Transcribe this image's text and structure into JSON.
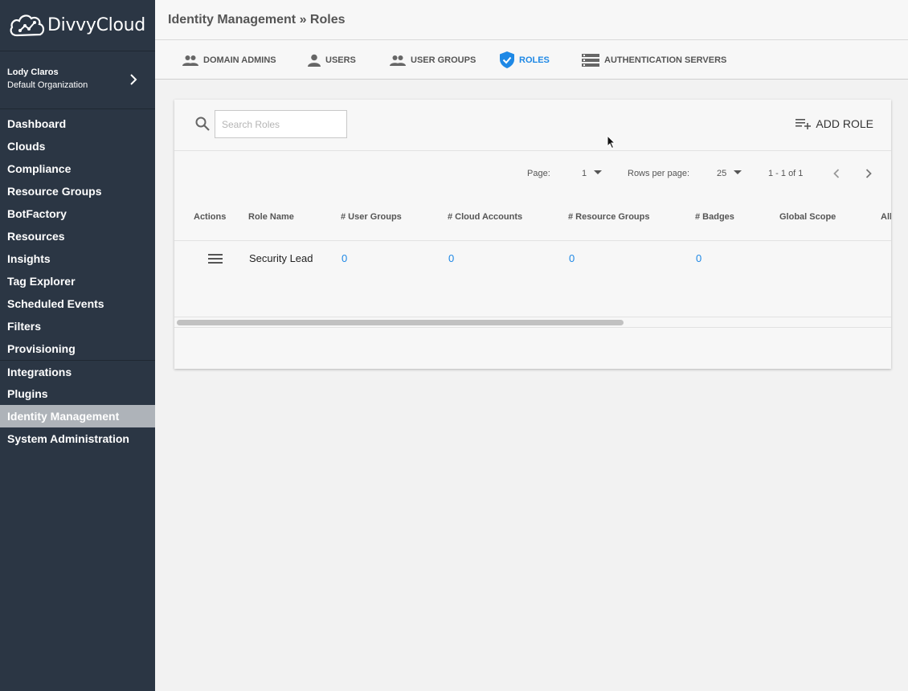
{
  "app": {
    "brand": "DivvyCloud"
  },
  "user": {
    "name": "Lody Claros",
    "org": "Default Organization"
  },
  "sidebar": {
    "items": [
      {
        "label": "Dashboard"
      },
      {
        "label": "Clouds"
      },
      {
        "label": "Compliance"
      },
      {
        "label": "Resource Groups"
      },
      {
        "label": "BotFactory"
      },
      {
        "label": "Resources"
      },
      {
        "label": "Insights"
      },
      {
        "label": "Tag Explorer"
      },
      {
        "label": "Scheduled Events"
      },
      {
        "label": "Filters"
      },
      {
        "label": "Provisioning"
      },
      {
        "label": "Integrations"
      },
      {
        "label": "Plugins"
      },
      {
        "label": "Identity Management"
      },
      {
        "label": "System Administration"
      }
    ],
    "active": "Identity Management"
  },
  "header": {
    "breadcrumb": "Identity Management » Roles"
  },
  "tabs": [
    {
      "label": "DOMAIN ADMINS",
      "icon": "people-icon"
    },
    {
      "label": "USERS",
      "icon": "person-icon"
    },
    {
      "label": "USER GROUPS",
      "icon": "people-icon"
    },
    {
      "label": "ROLES",
      "icon": "shield-check-icon",
      "active": true
    },
    {
      "label": "AUTHENTICATION SERVERS",
      "icon": "server-list-icon"
    }
  ],
  "toolbar": {
    "search_placeholder": "Search Roles",
    "add_label": "ADD ROLE"
  },
  "pager": {
    "page_label": "Page:",
    "page_value": "1",
    "rows_label": "Rows per page:",
    "rows_value": "25",
    "range": "1 - 1 of 1"
  },
  "table": {
    "columns": [
      "Actions",
      "Role Name",
      "# User Groups",
      "# Cloud Accounts",
      "# Resource Groups",
      "# Badges",
      "Global Scope",
      "All"
    ],
    "rows": [
      {
        "role_name": "Security Lead",
        "user_groups": "0",
        "cloud_accounts": "0",
        "resource_groups": "0",
        "badges": "0"
      }
    ]
  },
  "colors": {
    "sidebar_bg": "#2b3644",
    "accent": "#1e88e5",
    "active_nav": "#aeb3b9"
  }
}
